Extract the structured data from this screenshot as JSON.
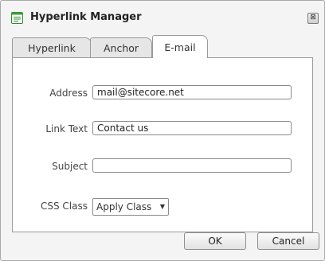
{
  "dialog": {
    "title": "Hyperlink Manager",
    "close_glyph": "⊠"
  },
  "tabs": [
    {
      "label": "Hyperlink",
      "active": false
    },
    {
      "label": "Anchor",
      "active": false
    },
    {
      "label": "E-mail",
      "active": true
    }
  ],
  "form": {
    "address": {
      "label": "Address",
      "value": "mail@sitecore.net"
    },
    "link_text": {
      "label": "Link Text",
      "value": "Contact us"
    },
    "subject": {
      "label": "Subject",
      "value": ""
    },
    "css_class": {
      "label": "CSS Class",
      "selected": "Apply Class"
    }
  },
  "buttons": {
    "ok": "OK",
    "cancel": "Cancel"
  }
}
